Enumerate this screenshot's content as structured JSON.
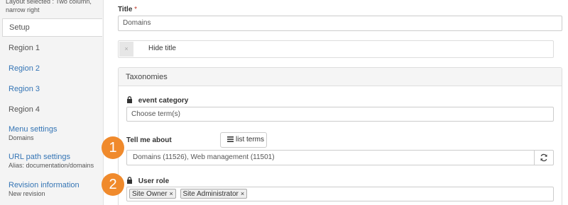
{
  "sidebar": {
    "layout_note": "Layout selected : Two column, narrow right",
    "items": [
      {
        "label": "Setup",
        "sub": ""
      },
      {
        "label": "Region 1",
        "sub": ""
      },
      {
        "label": "Region 2",
        "sub": ""
      },
      {
        "label": "Region 3",
        "sub": ""
      },
      {
        "label": "Region 4",
        "sub": ""
      },
      {
        "label": "Menu settings",
        "sub": "Domains"
      },
      {
        "label": "URL path settings",
        "sub": "Alias: documentation/domains"
      },
      {
        "label": "Revision information",
        "sub": "New revision"
      }
    ]
  },
  "main": {
    "title_label": "Title",
    "required_mark": "*",
    "title_value": "Domains",
    "hide_title_label": "Hide title",
    "taxonomies_heading": "Taxonomies",
    "event_category": {
      "label": "event category",
      "placeholder": "Choose term(s)"
    },
    "tell_me_about": {
      "label": "Tell me about",
      "list_terms_label": "list terms",
      "value": "Domains (11526), Web management (11501)"
    },
    "user_role": {
      "label": "User role",
      "tags": [
        "Site Owner",
        "Site Administrator"
      ],
      "remove_glyph": "×"
    }
  },
  "callouts": [
    "1",
    "2"
  ],
  "colors": {
    "accent_link": "#3575b5",
    "callout_orange": "#f08a2c",
    "required_red": "#c0392b"
  }
}
